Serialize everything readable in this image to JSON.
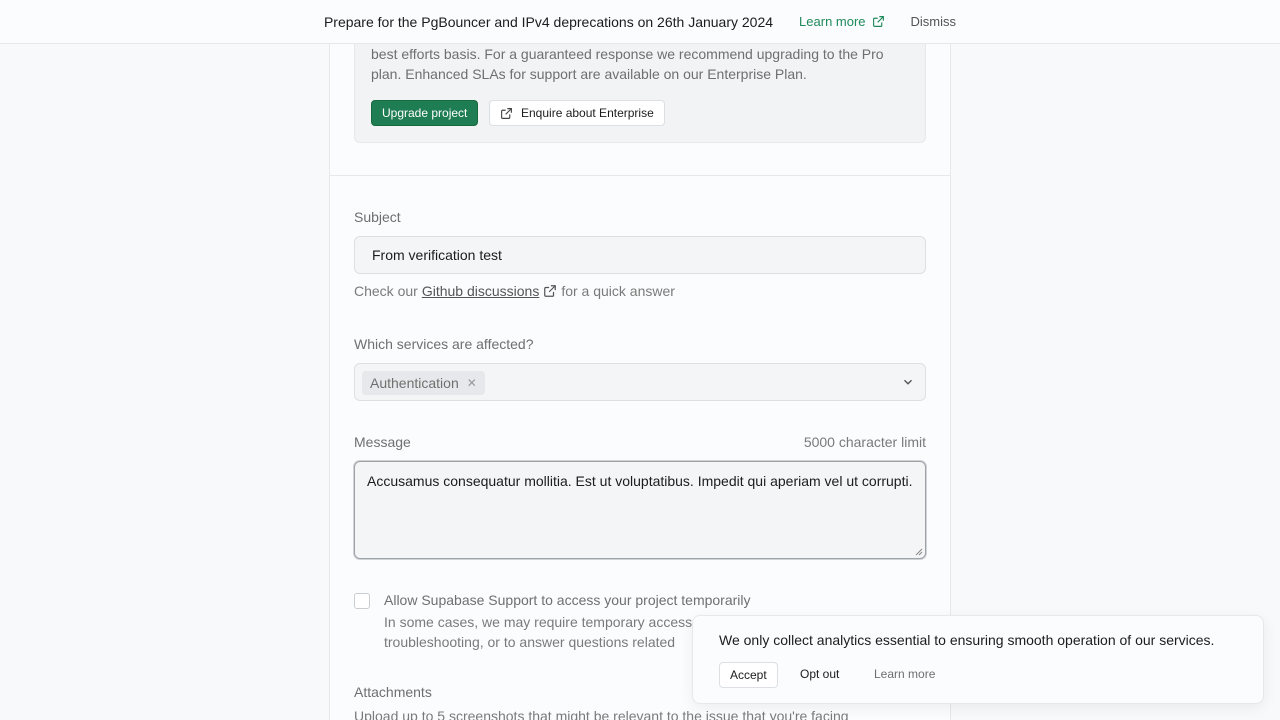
{
  "banner": {
    "text": "Prepare for the PgBouncer and IPv4 deprecations on 26th January 2024",
    "learn_more": "Learn more",
    "dismiss": "Dismiss"
  },
  "notice": {
    "text": "best efforts basis. For a guaranteed response we recommend upgrading to the Pro plan. Enhanced SLAs for support are available on our Enterprise Plan.",
    "upgrade_button": "Upgrade project",
    "enterprise_button": "Enquire about Enterprise"
  },
  "form": {
    "subject": {
      "label": "Subject",
      "value": "From verification test",
      "hint_prefix": "Check our",
      "hint_link": "Github discussions",
      "hint_suffix": "for a quick answer"
    },
    "services": {
      "label": "Which services are affected?",
      "selected": [
        "Authentication"
      ]
    },
    "message": {
      "label": "Message",
      "limit": "5000 character limit",
      "value": "Accusamus consequatur mollitia. Est ut voluptatibus. Impedit qui aperiam vel ut corrupti."
    },
    "access": {
      "title": "Allow Supabase Support to access your project temporarily",
      "description": "In some cases, we may require temporary access into your project to complete troubleshooting, or to answer questions related"
    },
    "attachments": {
      "label": "Attachments",
      "description": "Upload up to 5 screenshots that might be relevant to the issue that you're facing"
    }
  },
  "toast": {
    "text": "We only collect analytics essential to ensuring smooth operation of our services.",
    "accept": "Accept",
    "opt_out": "Opt out",
    "learn_more": "Learn more"
  },
  "colors": {
    "brand_green": "#1e7d52",
    "link_green": "#1f8a5b"
  }
}
